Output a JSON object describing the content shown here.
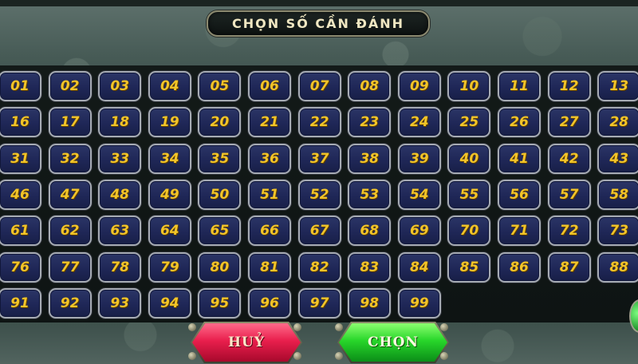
{
  "header": {
    "title": "CHỌN SỐ CẦN ĐÁNH"
  },
  "numbers": [
    [
      "01",
      "02",
      "03",
      "04",
      "05",
      "06",
      "07",
      "08",
      "09",
      "10",
      "11",
      "12",
      "13"
    ],
    [
      "16",
      "17",
      "18",
      "19",
      "20",
      "21",
      "22",
      "23",
      "24",
      "25",
      "26",
      "27",
      "28"
    ],
    [
      "31",
      "32",
      "33",
      "34",
      "35",
      "36",
      "37",
      "38",
      "39",
      "40",
      "41",
      "42",
      "43"
    ],
    [
      "46",
      "47",
      "48",
      "49",
      "50",
      "51",
      "52",
      "53",
      "54",
      "55",
      "56",
      "57",
      "58"
    ],
    [
      "61",
      "62",
      "63",
      "64",
      "65",
      "66",
      "67",
      "68",
      "69",
      "70",
      "71",
      "72",
      "73"
    ],
    [
      "76",
      "77",
      "78",
      "79",
      "80",
      "81",
      "82",
      "83",
      "84",
      "85",
      "86",
      "87",
      "88"
    ],
    [
      "91",
      "92",
      "93",
      "94",
      "95",
      "96",
      "97",
      "98",
      "99"
    ]
  ],
  "buttons": {
    "cancel_label": "HUỶ",
    "choose_label": "CHỌN"
  },
  "colors": {
    "number_text": "#f2c428",
    "cell_fill": "#1f2757",
    "cancel_button": "#e91f4d",
    "choose_button": "#28d62a"
  }
}
